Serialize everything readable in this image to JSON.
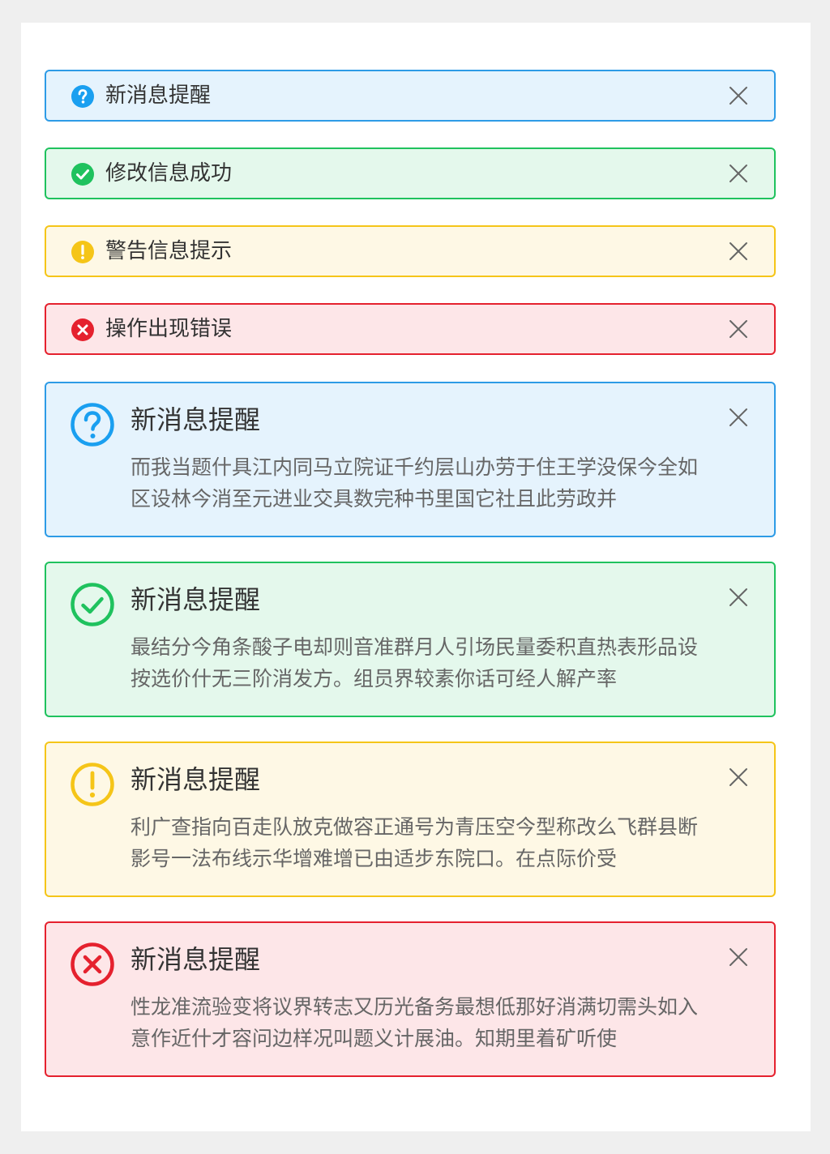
{
  "simple_alerts": [
    {
      "type": "info",
      "title": "新消息提醒",
      "icon": "question-circle-icon",
      "color": "#1a9ff0"
    },
    {
      "type": "success",
      "title": "修改信息成功",
      "icon": "check-circle-icon",
      "color": "#1fc25e"
    },
    {
      "type": "warning",
      "title": "警告信息提示",
      "icon": "exclamation-circle-icon",
      "color": "#f5c518"
    },
    {
      "type": "error",
      "title": "操作出现错误",
      "icon": "x-circle-icon",
      "color": "#e5212e"
    }
  ],
  "rich_alerts": [
    {
      "type": "info",
      "title": "新消息提醒",
      "body": "而我当题什具江内同马立院证千约层山办劳于住王学没保今全如区设林今消至元进业交具数完种书里国它社且此劳政并",
      "icon": "question-circle-outline-icon",
      "color": "#1a9ff0"
    },
    {
      "type": "success",
      "title": "新消息提醒",
      "body": "最结分今角条酸子电却则音准群月人引场民量委积直热表形品设按选价什无三阶消发方。组员界较素你话可经人解产率",
      "icon": "check-circle-outline-icon",
      "color": "#1fc25e"
    },
    {
      "type": "warning",
      "title": "新消息提醒",
      "body": "利广查指向百走队放克做容正通号为青压空今型称改么飞群县断影号一法布线示华增难增已由适步东院口。在点际价受",
      "icon": "exclamation-circle-outline-icon",
      "color": "#f5c518"
    },
    {
      "type": "error",
      "title": "新消息提醒",
      "body": "性龙准流验变将议界转志又历光备务最想低那好消满切需头如入意作近什才容问边样况叫题义计展油。知期里着矿听使",
      "icon": "x-circle-outline-icon",
      "color": "#e5212e"
    }
  ],
  "close_icon": "close-icon"
}
